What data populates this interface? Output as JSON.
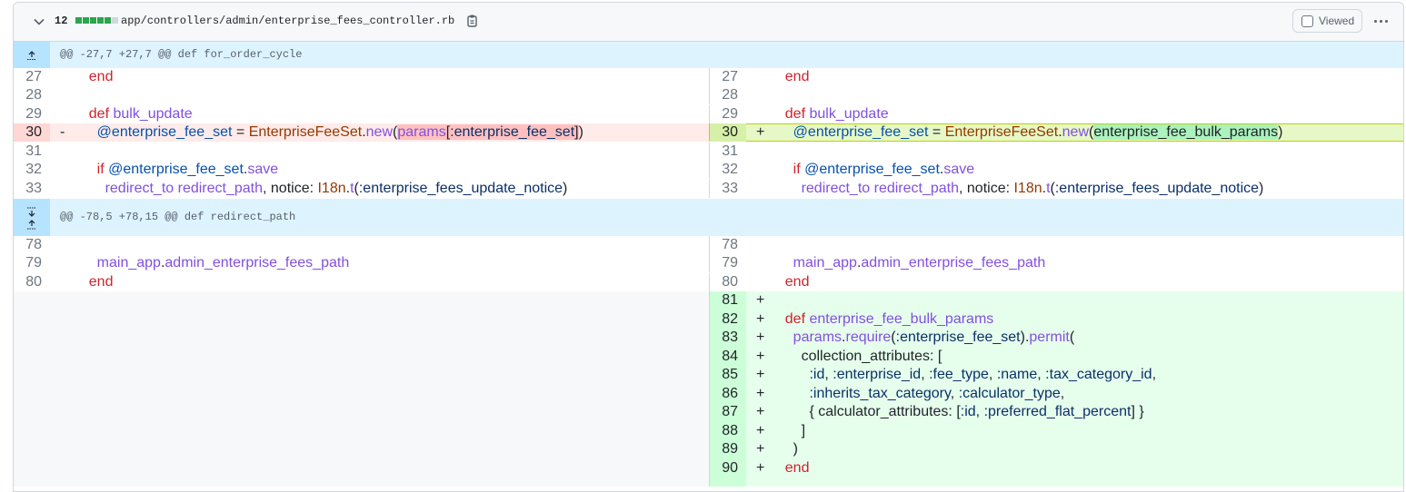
{
  "file": {
    "changes_count": "12",
    "path": "app/controllers/admin/enterprise_fees_controller.rb",
    "viewed_label": "Viewed",
    "diffstat": [
      "add",
      "add",
      "add",
      "add",
      "add",
      "neutral"
    ]
  },
  "colors": {
    "add": "#2da44e",
    "del": "#cf222e",
    "neutral": "#d0d7de",
    "accent": "#0969da"
  },
  "hunks": [
    {
      "header": "@@ -27,7 +27,7 @@ def for_order_cycle"
    },
    {
      "header": "@@ -78,5 +78,15 @@ def redirect_path"
    }
  ],
  "left_lines": [
    {
      "num": "27",
      "text": "    end"
    },
    {
      "num": "28",
      "text": ""
    },
    {
      "num": "29",
      "text": "    def bulk_update"
    },
    {
      "num": "30",
      "sign": "-",
      "text": "      @enterprise_fee_set = EnterpriseFeeSet.new(params[:enterprise_fee_set])"
    },
    {
      "num": "31",
      "text": ""
    },
    {
      "num": "32",
      "text": "      if @enterprise_fee_set.save"
    },
    {
      "num": "33",
      "text": "        redirect_to redirect_path, notice: I18n.t(:enterprise_fees_update_notice)"
    },
    {
      "num": "78",
      "text": ""
    },
    {
      "num": "79",
      "text": "      main_app.admin_enterprise_fees_path"
    },
    {
      "num": "80",
      "text": "    end"
    }
  ],
  "right_lines": [
    {
      "num": "27",
      "text": "    end"
    },
    {
      "num": "28",
      "text": ""
    },
    {
      "num": "29",
      "text": "    def bulk_update"
    },
    {
      "num": "30",
      "sign": "+",
      "text": "      @enterprise_fee_set = EnterpriseFeeSet.new(enterprise_fee_bulk_params)"
    },
    {
      "num": "31",
      "text": ""
    },
    {
      "num": "32",
      "text": "      if @enterprise_fee_set.save"
    },
    {
      "num": "33",
      "text": "        redirect_to redirect_path, notice: I18n.t(:enterprise_fees_update_notice)"
    },
    {
      "num": "78",
      "text": ""
    },
    {
      "num": "79",
      "text": "      main_app.admin_enterprise_fees_path"
    },
    {
      "num": "80",
      "text": "    end"
    },
    {
      "num": "81",
      "sign": "+",
      "text": ""
    },
    {
      "num": "82",
      "sign": "+",
      "text": "    def enterprise_fee_bulk_params"
    },
    {
      "num": "83",
      "sign": "+",
      "text": "      params.require(:enterprise_fee_set).permit("
    },
    {
      "num": "84",
      "sign": "+",
      "text": "        collection_attributes: ["
    },
    {
      "num": "85",
      "sign": "+",
      "text": "          :id, :enterprise_id, :fee_type, :name, :tax_category_id,"
    },
    {
      "num": "86",
      "sign": "+",
      "text": "          :inherits_tax_category, :calculator_type,"
    },
    {
      "num": "87",
      "sign": "+",
      "text": "          { calculator_attributes: [:id, :preferred_flat_percent] }"
    },
    {
      "num": "88",
      "sign": "+",
      "text": "        ]"
    },
    {
      "num": "89",
      "sign": "+",
      "text": "      )"
    },
    {
      "num": "90",
      "sign": "+",
      "text": "    end"
    }
  ]
}
